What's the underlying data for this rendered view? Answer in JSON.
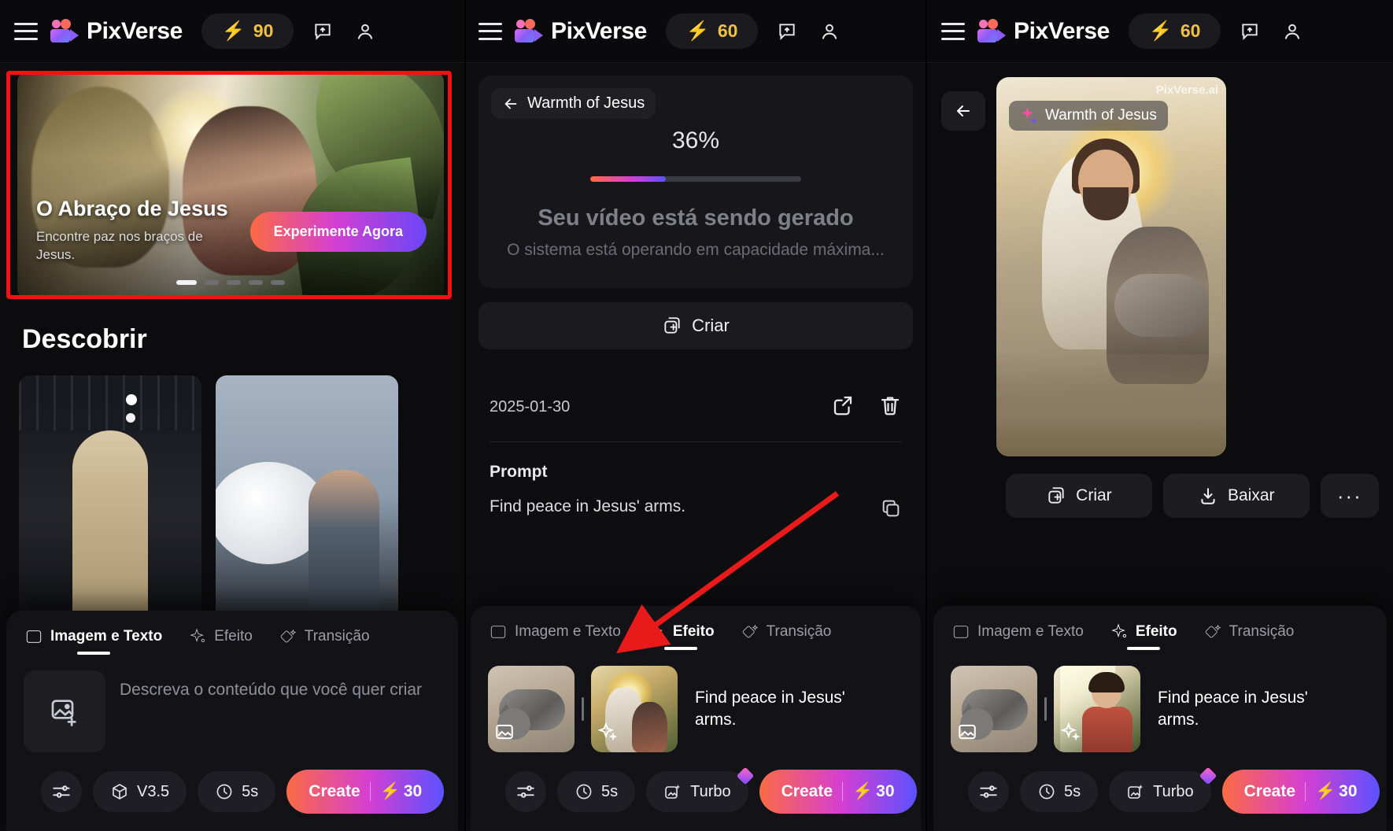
{
  "panels": [
    {
      "topbar": {
        "menu_icon": "hamburger-icon",
        "brand": "PixVerse",
        "credits": "90",
        "bolt_icon": "bolt-icon",
        "feedback_icon": "feedback-icon",
        "account_icon": "account-icon"
      },
      "hero": {
        "title": "O Abraço de Jesus",
        "subtitle": "Encontre paz nos braços de Jesus.",
        "cta": "Experimente Agora",
        "dots_total": 5,
        "active_dot": 1,
        "highlight_color": "#f41111"
      },
      "section_title": "Descobrir",
      "dock": {
        "tabs": [
          {
            "label": "Imagem e Texto",
            "icon": "image-icon",
            "active": true
          },
          {
            "label": "Efeito",
            "icon": "sparkle-icon",
            "active": false
          },
          {
            "label": "Transição",
            "icon": "transition-icon",
            "active": false
          }
        ],
        "upload_icon": "image-plus-icon",
        "prompt_placeholder": "Descreva o conteúdo que você quer criar",
        "settings_icon": "sliders-icon",
        "chips": [
          {
            "label": "V3.5",
            "icon": "cube-icon"
          },
          {
            "label": "5s",
            "icon": "clock-icon"
          }
        ],
        "create_label": "Create",
        "create_cost": "30"
      }
    },
    {
      "topbar": {
        "menu_icon": "hamburger-icon",
        "brand": "PixVerse",
        "credits": "60",
        "bolt_icon": "bolt-icon",
        "feedback_icon": "feedback-icon",
        "account_icon": "account-icon"
      },
      "progress": {
        "back_icon": "back-arrow-icon",
        "effect_title": "Warmth of Jesus",
        "percent": "36%",
        "percent_value": 36,
        "heading": "Seu vídeo está sendo gerado",
        "subheading": "O sistema está operando em capacidade máxima...",
        "criar_label": "Criar",
        "criar_icon": "copy-plus-icon"
      },
      "meta": {
        "date": "2025-01-30",
        "share_icon": "share-external-icon",
        "delete_icon": "trash-icon",
        "prompt_label": "Prompt",
        "prompt_text": "Find peace in Jesus' arms.",
        "copy_icon": "copy-icon"
      },
      "dock": {
        "tabs": [
          {
            "label": "Imagem e Texto",
            "icon": "image-icon",
            "active": false
          },
          {
            "label": "Efeito",
            "icon": "sparkle-icon",
            "active": true
          },
          {
            "label": "Transição",
            "icon": "transition-icon",
            "active": false
          }
        ],
        "thumb_a_badge": "image-icon",
        "thumb_b_badge": "sparkle-icon",
        "caption": "Find peace in Jesus' arms.",
        "settings_icon": "sliders-icon",
        "chips": [
          {
            "label": "5s",
            "icon": "clock-icon"
          },
          {
            "label": "Turbo",
            "icon": "turbo-icon",
            "gem": true
          }
        ],
        "create_label": "Create",
        "create_cost": "30"
      }
    },
    {
      "topbar": {
        "menu_icon": "hamburger-icon",
        "brand": "PixVerse",
        "credits": "60",
        "bolt_icon": "bolt-icon",
        "feedback_icon": "feedback-icon",
        "account_icon": "account-icon"
      },
      "result": {
        "back_icon": "back-arrow-icon",
        "watermark": "PixVerse.ai",
        "effect_tag": "Warmth of Jesus",
        "tag_icon": "sparkle-icon"
      },
      "actions": [
        {
          "label": "Criar",
          "icon": "copy-plus-icon"
        },
        {
          "label": "Baixar",
          "icon": "download-icon"
        },
        {
          "label": "···",
          "icon": "more-icon"
        }
      ],
      "dock": {
        "tabs": [
          {
            "label": "Imagem e Texto",
            "icon": "image-icon",
            "active": false
          },
          {
            "label": "Efeito",
            "icon": "sparkle-icon",
            "active": true
          },
          {
            "label": "Transição",
            "icon": "transition-icon",
            "active": false
          }
        ],
        "caption": "Find peace in Jesus' arms.",
        "settings_icon": "sliders-icon",
        "chips": [
          {
            "label": "5s",
            "icon": "clock-icon"
          },
          {
            "label": "Turbo",
            "icon": "turbo-icon",
            "gem": true
          }
        ],
        "create_label": "Create",
        "create_cost": "30"
      }
    }
  ],
  "annotation": {
    "arrow_color": "#e81a1a",
    "highlight_color": "#f41111"
  },
  "theme": {
    "bg": "#0c0c0e",
    "accent_gradient_start": "#fb6b43",
    "accent_gradient_mid": "#d53fd2",
    "accent_gradient_end": "#5b52ff",
    "credit_yellow": "#f0c040"
  }
}
